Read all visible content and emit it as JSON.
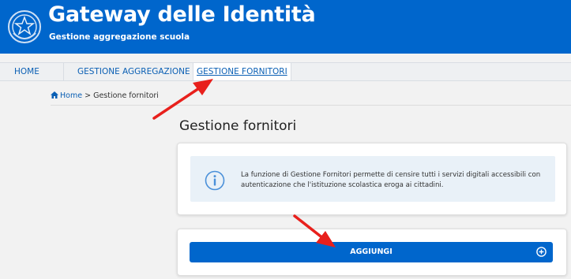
{
  "header": {
    "title": "Gateway delle Identità",
    "subtitle": "Gestione aggregazione scuola"
  },
  "nav": {
    "items": [
      {
        "label": "HOME"
      },
      {
        "label": "GESTIONE AGGREGAZIONE"
      },
      {
        "label": "GESTIONE FORNITORI",
        "active": true
      }
    ]
  },
  "breadcrumb": {
    "home": "Home",
    "separator": ">",
    "current": "Gestione fornitori"
  },
  "page": {
    "title": "Gestione fornitori",
    "info_text": "La funzione di Gestione Fornitori permette di censire tutti i servizi digitali accessibili con autenticazione che l'istituzione scolastica eroga ai cittadini.",
    "add_label": "AGGIUNGI"
  },
  "icons": {
    "emblem": "italian-republic-emblem",
    "home": "home-icon",
    "info": "info-icon",
    "add": "plus-circle-icon"
  },
  "colors": {
    "primary": "#0066cc",
    "annotation_arrow": "#e8201c",
    "info_background": "#e9f1f8"
  }
}
